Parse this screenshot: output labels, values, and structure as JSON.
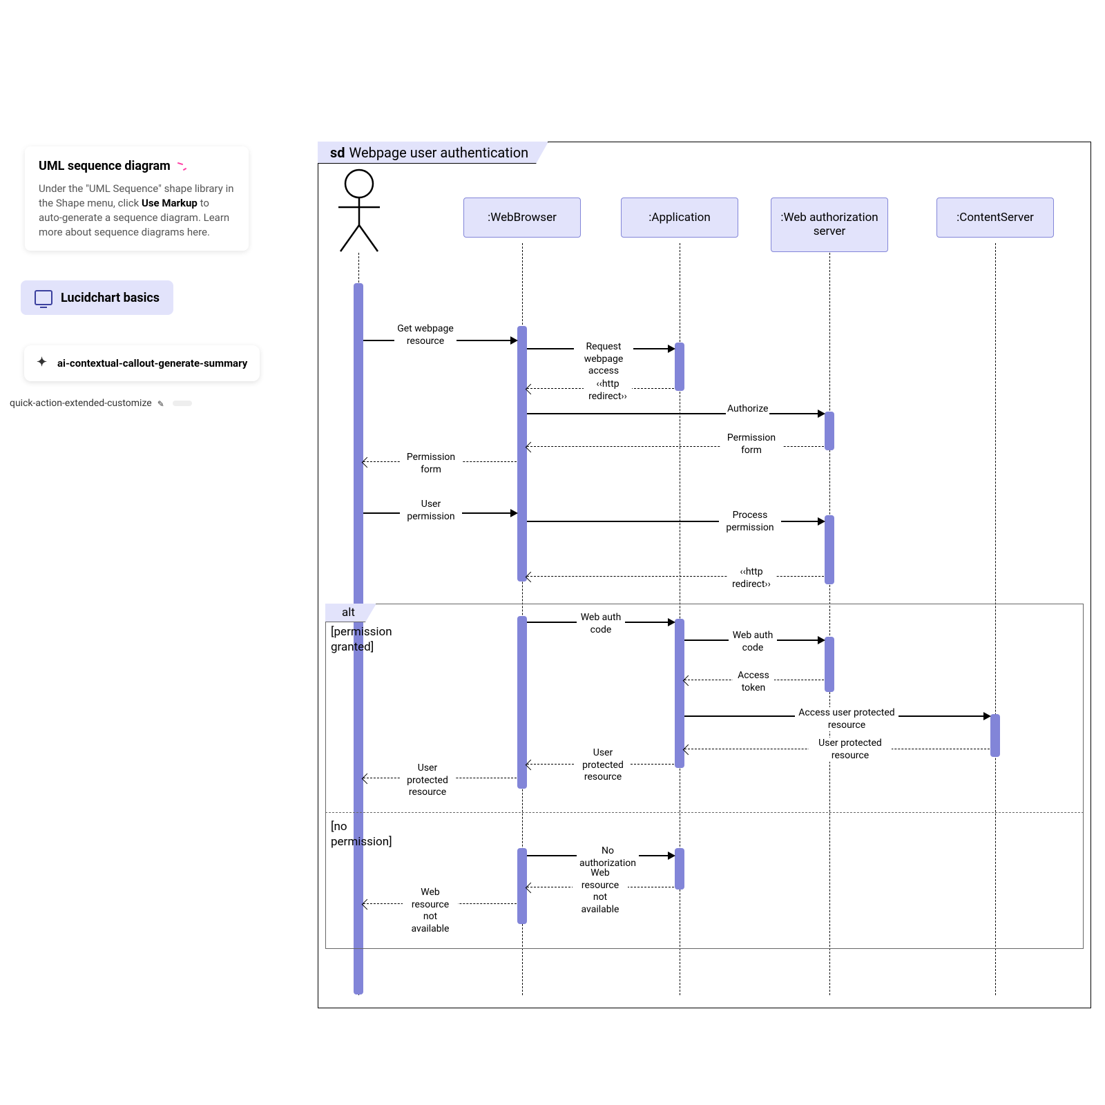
{
  "callout_tip": {
    "title": "UML sequence diagram",
    "body_before": "Under the \"UML Sequence\" shape library in the Shape menu, click ",
    "body_bold": "Use Markup",
    "body_after": " to auto-generate a sequence diagram. Learn more about sequence diagrams here."
  },
  "basics": {
    "label": "Lucidchart basics"
  },
  "ai_callout": {
    "label": "ai-contextual-callout-generate-summary"
  },
  "qa": {
    "label": "quick-action-extended-customize"
  },
  "diagram": {
    "sd_prefix": "sd",
    "sd_title": "Webpage user authentication",
    "lifelines": {
      "browser": ":WebBrowser",
      "app": ":Application",
      "auth": ":Web authorization server",
      "content": ":ContentServer"
    },
    "messages": {
      "get_resource": "Get webpage resource",
      "request_access": "Request webpage access",
      "redirect1": "‹‹http redirect››",
      "authorize": "Authorize",
      "perm_form_auth": "Permission form",
      "perm_form_user": "Permission form",
      "user_perm": "User permission",
      "process_perm": "Process permission",
      "redirect2": "‹‹http redirect››",
      "web_auth_code1": "Web auth code",
      "web_auth_code2": "Web auth code",
      "access_token": "Access token",
      "access_user_res": "Access user protected resource",
      "user_prot_res_cs": "User protected resource",
      "user_prot_res_app": "User protected resource",
      "user_prot_res_user": "User protected resource",
      "no_auth": "No authorization",
      "web_res_na_1": "Web resource not available",
      "web_res_na_2": "Web resource not available"
    },
    "alt": {
      "tab": "alt",
      "guard1": "[permission granted]",
      "guard2": "[no permission]"
    }
  }
}
